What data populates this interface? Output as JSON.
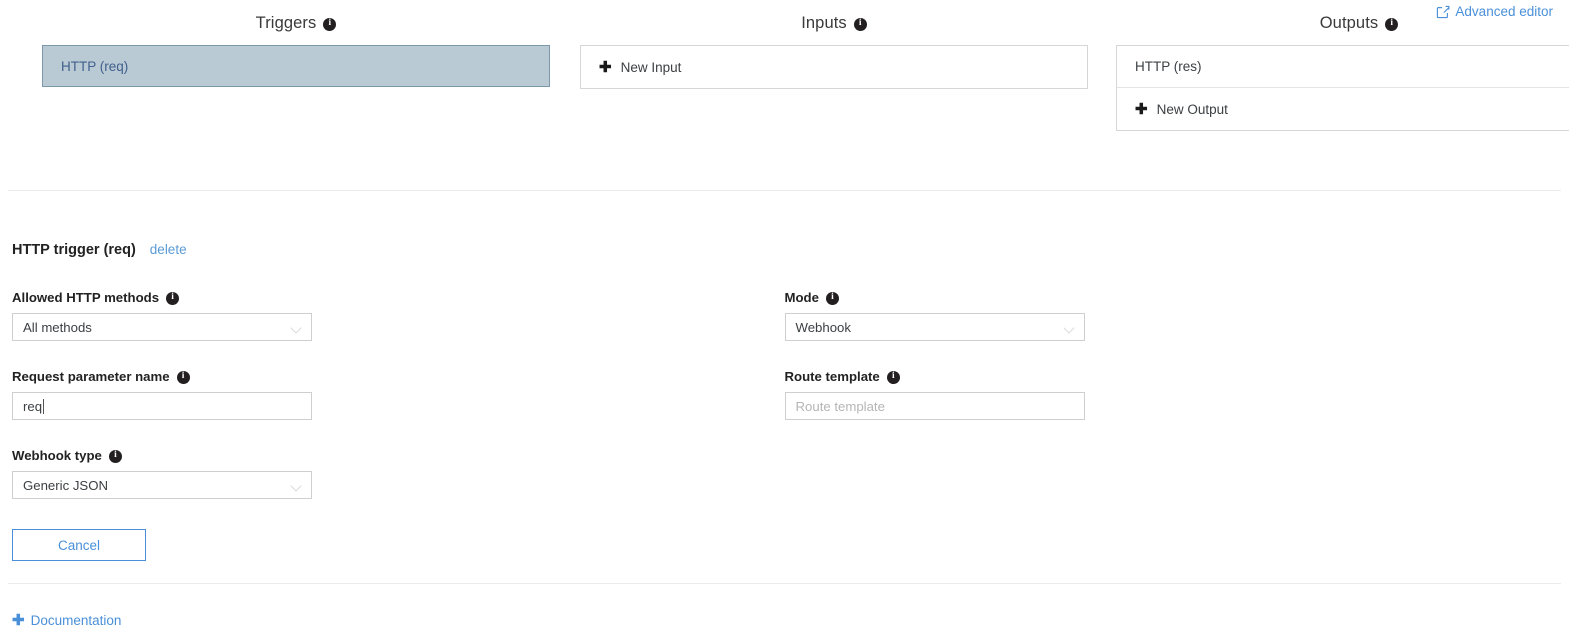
{
  "header": {
    "advanced_editor": {
      "label": "Advanced editor",
      "icon": "edit-square-icon"
    }
  },
  "columns": {
    "triggers": {
      "title": "Triggers",
      "info_icon": "info-icon",
      "items": [
        {
          "label": "HTTP (req)",
          "selected": true
        }
      ]
    },
    "inputs": {
      "title": "Inputs",
      "info_icon": "info-icon",
      "items": [],
      "new_label": "New Input",
      "new_icon": "plus-icon"
    },
    "outputs": {
      "title": "Outputs",
      "info_icon": "info-icon",
      "items": [
        {
          "label": "HTTP (res)"
        }
      ],
      "new_label": "New Output",
      "new_icon": "plus-icon"
    }
  },
  "detail": {
    "title": "HTTP trigger (req)",
    "delete_label": "delete",
    "fields": {
      "allowed_methods": {
        "label": "Allowed HTTP methods",
        "value": "All methods",
        "info_icon": "info-icon"
      },
      "mode": {
        "label": "Mode",
        "value": "Webhook",
        "info_icon": "info-icon"
      },
      "request_parameter_name": {
        "label": "Request parameter name",
        "value": "req",
        "info_icon": "info-icon"
      },
      "route_template": {
        "label": "Route template",
        "value": "",
        "placeholder": "Route template",
        "info_icon": "info-icon"
      },
      "webhook_type": {
        "label": "Webhook type",
        "value": "Generic JSON",
        "info_icon": "info-icon"
      }
    },
    "cancel_label": "Cancel"
  },
  "footer": {
    "documentation_label": "Documentation",
    "documentation_icon": "plus-icon"
  },
  "colors": {
    "link_blue": "#4a90d9",
    "selected_trigger_bg": "#b9cad4",
    "selected_trigger_border": "#7d98a8",
    "selected_trigger_text": "#41608c",
    "panel_border": "#d6d6d6",
    "divider": "#ececec",
    "text_primary": "#222222"
  }
}
